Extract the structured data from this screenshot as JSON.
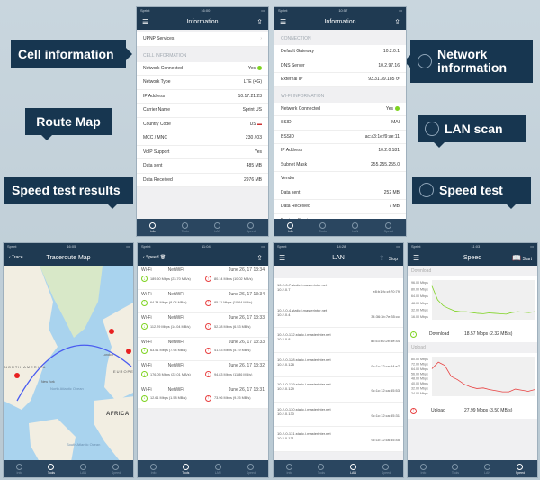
{
  "colors": {
    "navy": "#1f3a52",
    "green": "#7ed321",
    "red": "#e84040"
  },
  "labels": {
    "cell": "Cell information",
    "route": "Route Map",
    "speed_results": "Speed test results",
    "network": "Network information",
    "lan": "LAN scan",
    "speed": "Speed test"
  },
  "tabs": [
    "Info",
    "Tools",
    "LAN",
    "Speed"
  ],
  "cell": {
    "status_carrier": "Sprint",
    "time": "16:00",
    "title": "Information",
    "upnp": "UPNP Services",
    "section": "CELL INFORMATION",
    "rows": [
      [
        "Network Connected",
        "Yes"
      ],
      [
        "Network Type",
        "LTE (4G)"
      ],
      [
        "IP Address",
        "10.17.21.23"
      ],
      [
        "Carrier Name",
        "Sprint US"
      ],
      [
        "Country Code",
        "US"
      ],
      [
        "MCC / MNC",
        "230 / 03"
      ],
      [
        "VoIP Support",
        "Yes"
      ],
      [
        "Data sent",
        "485 MB"
      ],
      [
        "Data Received",
        "2976 MB"
      ]
    ]
  },
  "network": {
    "status_carrier": "Sprint",
    "time": "10:57",
    "title": "Information",
    "section1": "CONNECTION",
    "conn": [
      [
        "Default Gateway",
        "10.2.0.1"
      ],
      [
        "DNS Server",
        "10.2.97.16"
      ],
      [
        "External IP",
        "93.31.39.185"
      ]
    ],
    "section2": "WI-FI INFORMATION",
    "wifi": [
      [
        "Network Connected",
        "Yes"
      ],
      [
        "SSID",
        "MAI"
      ],
      [
        "BSSID",
        "ac:a3:1e:f9:ae:11"
      ],
      [
        "IP Address",
        "10.2.0.181"
      ],
      [
        "Subnet Mask",
        "255.255.255.0"
      ],
      [
        "Vendor",
        ""
      ],
      [
        "Data sent",
        "252 MB"
      ],
      [
        "Data Received",
        "7 MB"
      ],
      [
        "Bonjour Services",
        ""
      ]
    ]
  },
  "map": {
    "status_carrier": "Sprint",
    "time": "16:05",
    "back": "Trace",
    "title": "Traceroute Map",
    "places": [
      "NORTH AMERICA",
      "North Atlantic Ocean",
      "EUROPE",
      "AFRICA",
      "South Atlantic Ocean",
      "New York",
      "London"
    ]
  },
  "results": {
    "status_carrier": "Sprint",
    "time": "11:04",
    "back": "Speed",
    "items": [
      [
        "Wi-Fi",
        "NetWiFi",
        "June 26, 17 13:34",
        "189.60 Mbps (23.70 MB/s)",
        "80.14 Mbps (10.02 MB/s)"
      ],
      [
        "Wi-Fi",
        "NetWiFi",
        "June 26, 17 13:34",
        "64.34 Mbps (8.04 MB/s)",
        "85.11 Mbps (10.64 MB/s)"
      ],
      [
        "Wi-Fi",
        "NetWiFi",
        "June 26, 17 13:33",
        "112.29 Mbps (14.04 MB/s)",
        "52.28 Mbps (6.53 MB/s)"
      ],
      [
        "Wi-Fi",
        "NetWiFi",
        "June 26, 17 13:33",
        "63.51 Mbps (7.94 MB/s)",
        "41.53 Mbps (5.19 MB/s)"
      ],
      [
        "Wi-Fi",
        "NetWiFi",
        "June 26, 17 13:32",
        "176.05 Mbps (22.01 MB/s)",
        "94.83 Mbps (11.86 MB/s)"
      ],
      [
        "Wi-Fi",
        "NetWiFi",
        "June 26, 17 13:31",
        "12.61 Mbps (1.58 MB/s)",
        "73.96 Mbps (9.25 MB/s)"
      ]
    ]
  },
  "lan": {
    "status_carrier": "Sprint",
    "time": "14:28",
    "title": "LAN",
    "stop": "Stop",
    "hosts": [
      [
        "10-2-0-7.static.i.masterinter.net",
        "10.2.0.7",
        "e8:b1:fc:cf:70:79"
      ],
      [
        "10-2-0-4.static.i.masterinter.net",
        "10.2.0.4",
        "34:36:3b:7e:35:cc"
      ],
      [
        "10-2-0-132.static.i.masterinter.net",
        "10.2.0.8",
        "dc:53:60:2b:5e:44"
      ],
      [
        "10-2-0-128.static.i.masterinter.net",
        "10.2.0.128",
        "9c:1c:12:ca:54:e7"
      ],
      [
        "10-2-0-129.static.i.masterinter.net",
        "10.2.0.129",
        "9c:1c:12:ca:55:53"
      ],
      [
        "10-2-0-130.static.i.masterinter.net",
        "10.2.0.130",
        "9c:1c:12:ca:55:31"
      ],
      [
        "10-2-0-131.static.i.masterinter.net",
        "10.2.0.131",
        "9c:1c:12:ca:55:45"
      ]
    ]
  },
  "speed": {
    "status_carrier": "Sprint",
    "time": "11:03",
    "title": "Speed",
    "start": "Start",
    "download_header": "Download",
    "upload_header": "Upload",
    "download_label": "Download",
    "download_value": "18.57 Mbps (2.32 MB/s)",
    "upload_label": "Upload",
    "upload_value": "27.99 Mbps (3.50 MB/s)"
  },
  "chart_data": [
    {
      "type": "line",
      "title": "Download",
      "ylabel": "Mbps",
      "yticks": [
        "96.00 Mbps",
        "80.00 Mbps",
        "64.00 Mbps",
        "48.00 Mbps",
        "32.00 Mbps",
        "16.00 Mbps"
      ],
      "ylim": [
        0,
        100
      ],
      "values": [
        85,
        50,
        35,
        28,
        22,
        20,
        20,
        18,
        16,
        15,
        17,
        16,
        15,
        14,
        18,
        20,
        19,
        18,
        20
      ]
    },
    {
      "type": "line",
      "title": "Upload",
      "ylabel": "Mbps",
      "yticks": [
        "80.00 Mbps",
        "72.00 Mbps",
        "64.00 Mbps",
        "56.00 Mbps",
        "48.00 Mbps",
        "40.00 Mbps",
        "32.00 Mbps",
        "24.00 Mbps"
      ],
      "ylim": [
        16,
        88
      ],
      "values": [
        66,
        78,
        72,
        52,
        46,
        38,
        33,
        30,
        31,
        28,
        26,
        24,
        24,
        29,
        27,
        25,
        28
      ]
    }
  ]
}
